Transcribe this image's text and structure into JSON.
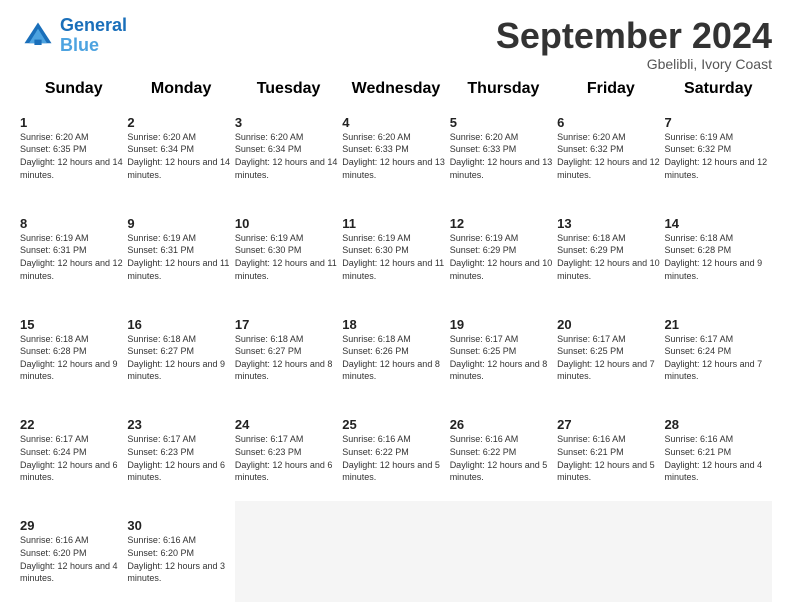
{
  "header": {
    "logo_line1": "General",
    "logo_line2": "Blue",
    "month": "September 2024",
    "location": "Gbelibli, Ivory Coast"
  },
  "days_of_week": [
    "Sunday",
    "Monday",
    "Tuesday",
    "Wednesday",
    "Thursday",
    "Friday",
    "Saturday"
  ],
  "weeks": [
    [
      {
        "num": "1",
        "sunrise": "6:20 AM",
        "sunset": "6:35 PM",
        "daylight": "12 hours and 14 minutes."
      },
      {
        "num": "2",
        "sunrise": "6:20 AM",
        "sunset": "6:34 PM",
        "daylight": "12 hours and 14 minutes."
      },
      {
        "num": "3",
        "sunrise": "6:20 AM",
        "sunset": "6:34 PM",
        "daylight": "12 hours and 14 minutes."
      },
      {
        "num": "4",
        "sunrise": "6:20 AM",
        "sunset": "6:33 PM",
        "daylight": "12 hours and 13 minutes."
      },
      {
        "num": "5",
        "sunrise": "6:20 AM",
        "sunset": "6:33 PM",
        "daylight": "12 hours and 13 minutes."
      },
      {
        "num": "6",
        "sunrise": "6:20 AM",
        "sunset": "6:32 PM",
        "daylight": "12 hours and 12 minutes."
      },
      {
        "num": "7",
        "sunrise": "6:19 AM",
        "sunset": "6:32 PM",
        "daylight": "12 hours and 12 minutes."
      }
    ],
    [
      {
        "num": "8",
        "sunrise": "6:19 AM",
        "sunset": "6:31 PM",
        "daylight": "12 hours and 12 minutes."
      },
      {
        "num": "9",
        "sunrise": "6:19 AM",
        "sunset": "6:31 PM",
        "daylight": "12 hours and 11 minutes."
      },
      {
        "num": "10",
        "sunrise": "6:19 AM",
        "sunset": "6:30 PM",
        "daylight": "12 hours and 11 minutes."
      },
      {
        "num": "11",
        "sunrise": "6:19 AM",
        "sunset": "6:30 PM",
        "daylight": "12 hours and 11 minutes."
      },
      {
        "num": "12",
        "sunrise": "6:19 AM",
        "sunset": "6:29 PM",
        "daylight": "12 hours and 10 minutes."
      },
      {
        "num": "13",
        "sunrise": "6:18 AM",
        "sunset": "6:29 PM",
        "daylight": "12 hours and 10 minutes."
      },
      {
        "num": "14",
        "sunrise": "6:18 AM",
        "sunset": "6:28 PM",
        "daylight": "12 hours and 9 minutes."
      }
    ],
    [
      {
        "num": "15",
        "sunrise": "6:18 AM",
        "sunset": "6:28 PM",
        "daylight": "12 hours and 9 minutes."
      },
      {
        "num": "16",
        "sunrise": "6:18 AM",
        "sunset": "6:27 PM",
        "daylight": "12 hours and 9 minutes."
      },
      {
        "num": "17",
        "sunrise": "6:18 AM",
        "sunset": "6:27 PM",
        "daylight": "12 hours and 8 minutes."
      },
      {
        "num": "18",
        "sunrise": "6:18 AM",
        "sunset": "6:26 PM",
        "daylight": "12 hours and 8 minutes."
      },
      {
        "num": "19",
        "sunrise": "6:17 AM",
        "sunset": "6:25 PM",
        "daylight": "12 hours and 8 minutes."
      },
      {
        "num": "20",
        "sunrise": "6:17 AM",
        "sunset": "6:25 PM",
        "daylight": "12 hours and 7 minutes."
      },
      {
        "num": "21",
        "sunrise": "6:17 AM",
        "sunset": "6:24 PM",
        "daylight": "12 hours and 7 minutes."
      }
    ],
    [
      {
        "num": "22",
        "sunrise": "6:17 AM",
        "sunset": "6:24 PM",
        "daylight": "12 hours and 6 minutes."
      },
      {
        "num": "23",
        "sunrise": "6:17 AM",
        "sunset": "6:23 PM",
        "daylight": "12 hours and 6 minutes."
      },
      {
        "num": "24",
        "sunrise": "6:17 AM",
        "sunset": "6:23 PM",
        "daylight": "12 hours and 6 minutes."
      },
      {
        "num": "25",
        "sunrise": "6:16 AM",
        "sunset": "6:22 PM",
        "daylight": "12 hours and 5 minutes."
      },
      {
        "num": "26",
        "sunrise": "6:16 AM",
        "sunset": "6:22 PM",
        "daylight": "12 hours and 5 minutes."
      },
      {
        "num": "27",
        "sunrise": "6:16 AM",
        "sunset": "6:21 PM",
        "daylight": "12 hours and 5 minutes."
      },
      {
        "num": "28",
        "sunrise": "6:16 AM",
        "sunset": "6:21 PM",
        "daylight": "12 hours and 4 minutes."
      }
    ],
    [
      {
        "num": "29",
        "sunrise": "6:16 AM",
        "sunset": "6:20 PM",
        "daylight": "12 hours and 4 minutes."
      },
      {
        "num": "30",
        "sunrise": "6:16 AM",
        "sunset": "6:20 PM",
        "daylight": "12 hours and 3 minutes."
      },
      null,
      null,
      null,
      null,
      null
    ]
  ]
}
